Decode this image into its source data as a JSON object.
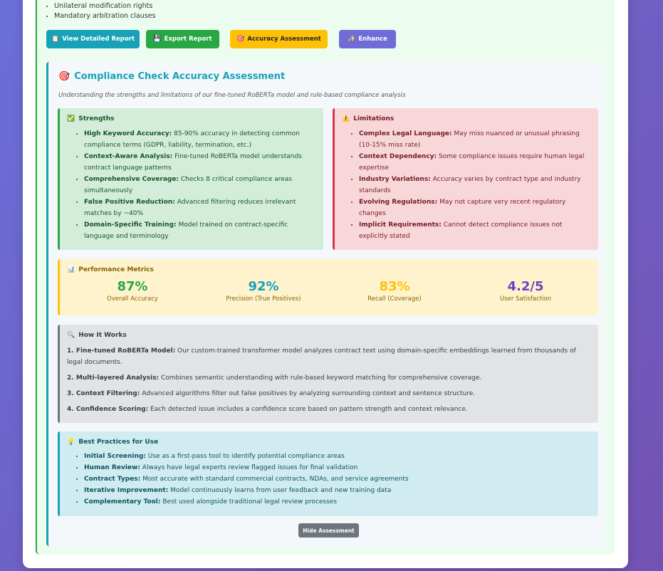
{
  "top_list": [
    "Unilateral modification rights",
    "Mandatory arbitration clauses"
  ],
  "buttons": {
    "view_report": "View Detailed Report",
    "export_report": "Export Report",
    "accuracy": "Accuracy Assessment",
    "enhance": "Enhance"
  },
  "assessment": {
    "title": "Compliance Check Accuracy Assessment",
    "subtitle": "Understanding the strengths and limitations of our fine-tuned RoBERTa model and rule-based compliance analysis",
    "strengths": {
      "heading": "Strengths",
      "items": [
        {
          "label": "High Keyword Accuracy:",
          "text": " 85-90% accuracy in detecting common compliance terms (GDPR, liability, termination, etc.)"
        },
        {
          "label": "Context-Aware Analysis:",
          "text": " Fine-tuned RoBERTa model understands contract language patterns"
        },
        {
          "label": "Comprehensive Coverage:",
          "text": " Checks 8 critical compliance areas simultaneously"
        },
        {
          "label": "False Positive Reduction:",
          "text": " Advanced filtering reduces irrelevant matches by ~40%"
        },
        {
          "label": "Domain-Specific Training:",
          "text": " Model trained on contract-specific language and terminology"
        }
      ]
    },
    "limitations": {
      "heading": "Limitations",
      "items": [
        {
          "label": "Complex Legal Language:",
          "text": " May miss nuanced or unusual phrasing (10-15% miss rate)"
        },
        {
          "label": "Context Dependency:",
          "text": " Some compliance issues require human legal expertise"
        },
        {
          "label": "Industry Variations:",
          "text": " Accuracy varies by contract type and industry standards"
        },
        {
          "label": "Evolving Regulations:",
          "text": " May not capture very recent regulatory changes"
        },
        {
          "label": "Implicit Requirements:",
          "text": " Cannot detect compliance issues not explicitly stated"
        }
      ]
    },
    "metrics": {
      "heading": "Performance Metrics",
      "items": [
        {
          "value": "87%",
          "label": "Overall Accuracy",
          "color": "#28a745"
        },
        {
          "value": "92%",
          "label": "Precision (True Positives)",
          "color": "#17a2b8"
        },
        {
          "value": "83%",
          "label": "Recall (Coverage)",
          "color": "#ffc107"
        },
        {
          "value": "4.2/5",
          "label": "User Satisfaction",
          "color": "#6f42c1"
        }
      ]
    },
    "how": {
      "heading": "How It Works",
      "items": [
        {
          "label": "1. Fine-tuned RoBERTa Model:",
          "text": " Our custom-trained transformer model analyzes contract text using domain-specific embeddings learned from thousands of legal documents."
        },
        {
          "label": "2. Multi-layered Analysis:",
          "text": " Combines semantic understanding with rule-based keyword matching for comprehensive coverage."
        },
        {
          "label": "3. Context Filtering:",
          "text": " Advanced algorithms filter out false positives by analyzing surrounding context and sentence structure."
        },
        {
          "label": "4. Confidence Scoring:",
          "text": " Each detected issue includes a confidence score based on pattern strength and context relevance."
        }
      ]
    },
    "best": {
      "heading": "Best Practices for Use",
      "items": [
        {
          "label": "Initial Screening:",
          "text": " Use as a first-pass tool to identify potential compliance areas"
        },
        {
          "label": "Human Review:",
          "text": " Always have legal experts review flagged issues for final validation"
        },
        {
          "label": "Contract Types:",
          "text": " Most accurate with standard commercial contracts, NDAs, and service agreements"
        },
        {
          "label": "Iterative Improvement:",
          "text": " Model continuously learns from user feedback and new training data"
        },
        {
          "label": "Complementary Tool:",
          "text": " Best used alongside traditional legal review processes"
        }
      ]
    },
    "hide_label": "Hide Assessment"
  },
  "colors": {
    "view_btn": "#17a2b8",
    "export_btn": "#28a745",
    "accuracy_btn": "#ffc107",
    "enhance_btn": "#6f6cd8"
  }
}
